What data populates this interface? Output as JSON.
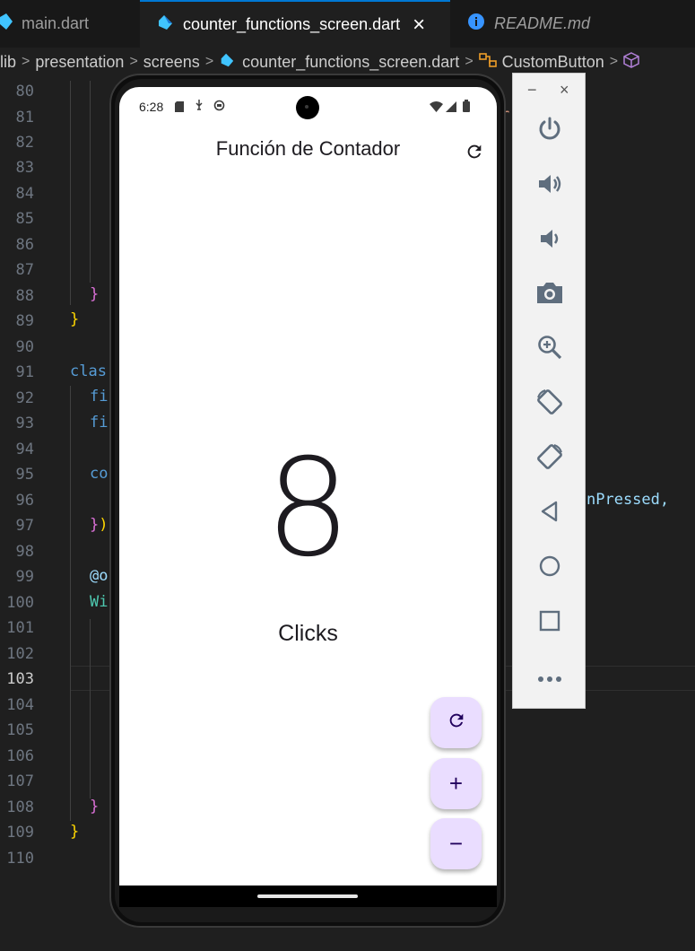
{
  "editor": {
    "tabs": [
      {
        "label": "main.dart"
      },
      {
        "label": "counter_functions_screen.dart",
        "close": "×"
      },
      {
        "label": "README.md"
      }
    ],
    "breadcrumb": [
      "lib",
      "presentation",
      "screens",
      "counter_functions_screen.dart",
      "CustomButton"
    ],
    "line_numbers": [
      "80",
      "81",
      "82",
      "83",
      "84",
      "85",
      "86",
      "87",
      "88",
      "89",
      "90",
      "91",
      "92",
      "93",
      "94",
      "95",
      "96",
      "97",
      "98",
      "99",
      "100",
      "101",
      "102",
      "103",
      "104",
      "105",
      "106",
      "107",
      "108",
      "109",
      "110"
    ],
    "current_line": "103",
    "code_fragments": {
      "brace_88": "}",
      "brace_89": "}",
      "clas": "clas",
      "fi_92": "fi",
      "fi_93": "fi",
      "co_95": "co",
      "close_97a": "}",
      "close_97b": ")",
      "at_o": "@o",
      "wi": "Wi",
      "brace_108": "}",
      "brace_109": "}",
      "onpressed": "nPressed,",
      "r_81": "r"
    },
    "colors": {
      "accent": "#0078d4",
      "background": "#1f1f1f",
      "brace_pink": "#da70d6",
      "brace_gold": "#ffd700",
      "keyword_blue": "#569cd6",
      "type_teal": "#4ec9b0",
      "property_light": "#9cdcfe"
    }
  },
  "phone": {
    "status": {
      "time": "6:28",
      "icons_left": [
        "sd-card-icon",
        "usb-icon",
        "sync-icon"
      ],
      "icons_right": [
        "wifi-icon",
        "signal-icon",
        "battery-icon"
      ]
    },
    "app": {
      "title": "Función de Contador",
      "counter_value": "8",
      "counter_label": "Clicks",
      "fabs": [
        {
          "name": "reset-fab",
          "symbol": "↻"
        },
        {
          "name": "increment-fab",
          "symbol": "+"
        },
        {
          "name": "decrement-fab",
          "symbol": "−"
        }
      ],
      "colors": {
        "fab_bg": "#eaddff",
        "fab_icon": "#21005d",
        "screen_bg": "#ffffff"
      }
    }
  },
  "emulator_toolbar": {
    "window_controls": {
      "minimize": "−",
      "close": "×"
    },
    "buttons": [
      "power-icon",
      "volume-up-icon",
      "volume-down-icon",
      "camera-icon",
      "zoom-icon",
      "rotate-left-icon",
      "rotate-right-icon",
      "back-icon",
      "home-icon",
      "overview-icon",
      "more-icon"
    ]
  }
}
